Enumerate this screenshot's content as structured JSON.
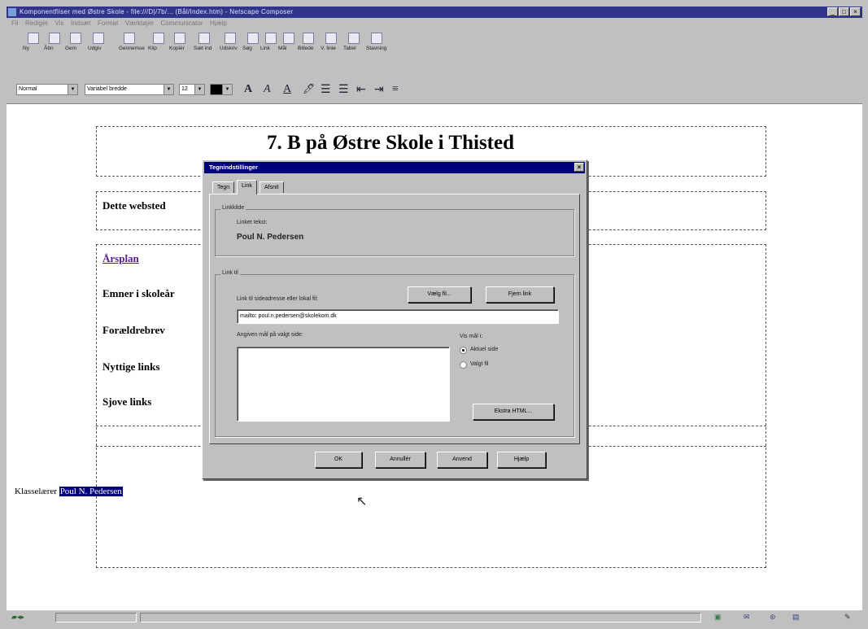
{
  "window": {
    "title": "Komponentfliser med Østre Skole - file:///D|/7b/... (Bål/Index.htm) - Netscape Composer",
    "min": "_",
    "max": "□",
    "close": "×"
  },
  "menu": [
    "Fil",
    "Redigér",
    "Vis",
    "Indsæt",
    "Format",
    "Værktøjer",
    "Communicator",
    "Hjælp"
  ],
  "toolbar": [
    {
      "label": "Ny",
      "icon": "new-icon"
    },
    {
      "label": "Åbn",
      "icon": "open-icon"
    },
    {
      "label": "Gem",
      "icon": "save-icon"
    },
    {
      "label": "Udgiv",
      "icon": "publish-icon"
    },
    {
      "label": "Gennemse",
      "icon": "preview-icon"
    },
    {
      "label": "Klip",
      "icon": "cut-icon"
    },
    {
      "label": "Kopiér",
      "icon": "copy-icon"
    },
    {
      "label": "Sæt ind",
      "icon": "paste-icon"
    },
    {
      "label": "Udskriv",
      "icon": "print-icon"
    },
    {
      "label": "Søg",
      "icon": "search-icon"
    },
    {
      "label": "Link",
      "icon": "link-icon"
    },
    {
      "label": "Mål",
      "icon": "target-icon"
    },
    {
      "label": "Billede",
      "icon": "image-icon"
    },
    {
      "label": "V. linie",
      "icon": "hrule-icon"
    },
    {
      "label": "Tabel",
      "icon": "table-icon"
    },
    {
      "label": "Stavning",
      "icon": "spell-icon"
    }
  ],
  "format": {
    "style": "Normal",
    "font": "Variabel bredde",
    "size": "12",
    "icons": [
      "A",
      "A",
      "A",
      "🖊",
      "☰",
      "☰",
      "⇤",
      "⇥",
      "≡"
    ]
  },
  "document": {
    "heading": "7. B på Østre Skole i Thisted",
    "intro": "Dette websted",
    "nav": [
      "Årsplan",
      "Emner i skoleår",
      "Forældrebrev",
      "Nyttige links",
      "Sjove links"
    ],
    "teacher_label": "Klasselærer",
    "teacher_name": "Poul N. Pedersen"
  },
  "dialog": {
    "title": "Tegnindstillinger",
    "close": "×",
    "tabs": [
      "Tegn",
      "Link",
      "Afsnit"
    ],
    "active_tab": "Link",
    "linkkilde_legend": "Linkkilde",
    "linked_text_label": "Linket tekst:",
    "linked_text": "Poul N. Pedersen",
    "linktil_legend": "Link til",
    "url_label": "Link til sideadresse eller lokal fil:",
    "choose_file": "Vælg fil...",
    "remove_link": "Fjern link",
    "url_value": "mailto: poul.n.pedersen@skolekom.dk",
    "targets_label": "Angiven mål på valgt side:",
    "show_label": "Vis mål i:",
    "radio_current": "Aktuel side",
    "radio_file": "Valgt fil",
    "extra_html": "Ekstra HTML...",
    "ok": "OK",
    "cancel": "Annullér",
    "apply": "Anvend",
    "help": "Hjælp"
  }
}
